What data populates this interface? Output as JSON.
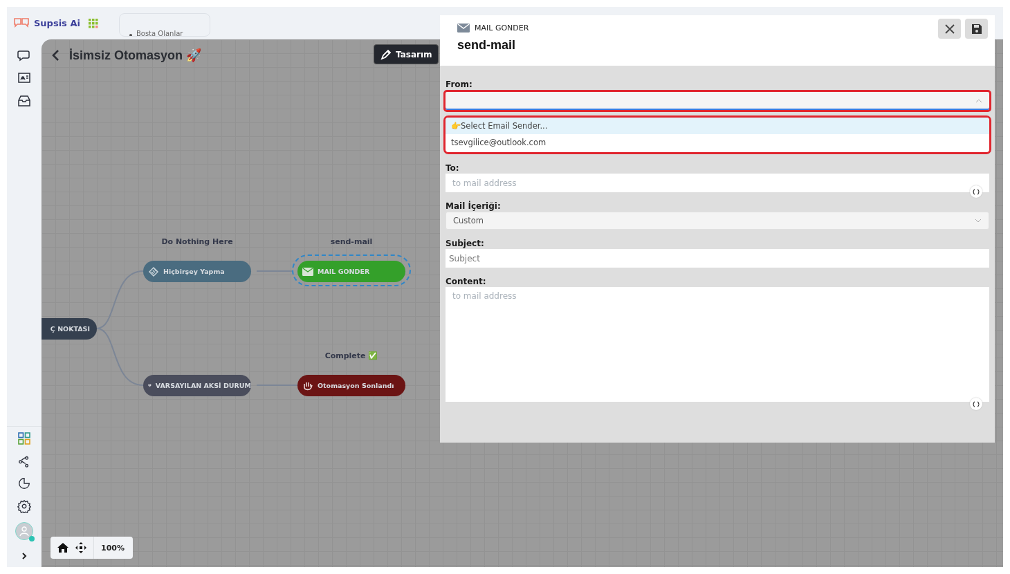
{
  "header": {
    "brand": "Supsis Ai",
    "top_tab": "Bosta Olanlar"
  },
  "sidebar": {
    "top_items": [
      {
        "kind": "chat"
      },
      {
        "kind": "contact"
      },
      {
        "kind": "inbox"
      }
    ],
    "bottom_items": [
      {
        "kind": "apps"
      },
      {
        "kind": "share"
      },
      {
        "kind": "report"
      },
      {
        "kind": "settings"
      }
    ],
    "user_online": true
  },
  "canvas": {
    "title": "İsimsiz Otomasyon 🚀",
    "design_button": "Tasarım",
    "zoom": "100%",
    "nodes": [
      {
        "kind": "start",
        "label": "Ç NOKTASI",
        "color": "#35404f",
        "selected": false
      },
      {
        "kind": "noop",
        "label": "Hiçbirşey Yapma",
        "caption": "Do Nothing Here",
        "color": "#4a6c80",
        "selected": false
      },
      {
        "kind": "mail",
        "label": "MAIL GONDER",
        "caption": "send-mail",
        "color": "#34a02a",
        "selected": true
      },
      {
        "kind": "fallback",
        "label": "VARSAYILAN AKSİ DURUM",
        "color": "#4a4d5c",
        "selected": false
      },
      {
        "kind": "end",
        "label": "Otomasyon Sonlandı",
        "caption": "Complete ✅",
        "color": "#6b1414",
        "selected": false
      }
    ]
  },
  "panel": {
    "type": "MAIL GONDER",
    "title": "send-mail",
    "fields": [
      {
        "kind": "select",
        "label": "From:",
        "expanded": true,
        "options": [
          {
            "label": "👉Select Email Sender...",
            "selected": true
          },
          {
            "label": "tsevgilice@outlook.com",
            "selected": false
          }
        ]
      },
      {
        "kind": "input",
        "label": "To:",
        "placeholder": "to mail address",
        "variable": true
      },
      {
        "kind": "select",
        "label": "Mail İçeriği:",
        "value": "Custom",
        "expanded": false
      },
      {
        "kind": "input",
        "label": "Subject:",
        "placeholder": "Subject",
        "variable": false
      },
      {
        "kind": "textarea",
        "label": "Content:",
        "placeholder": "to mail address",
        "variable": true
      }
    ]
  }
}
